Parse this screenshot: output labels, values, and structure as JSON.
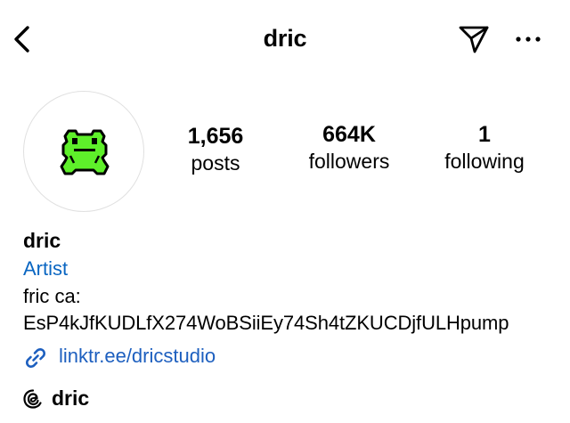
{
  "header": {
    "title": "dric",
    "back_icon": "chevron-left-icon",
    "send_icon": "paper-plane-icon",
    "more_icon": "more-horizontal-icon"
  },
  "profile": {
    "avatar_icon": "green-frog-icon",
    "stats": {
      "posts": {
        "value": "1,656",
        "label": "posts"
      },
      "followers": {
        "value": "664K",
        "label": "followers"
      },
      "following": {
        "value": "1",
        "label": "following"
      }
    }
  },
  "bio": {
    "name": "dric",
    "category": "Artist",
    "line1": "fric ca:",
    "line2": "EsP4kJfKUDLfX274WoBSiiEy74Sh4tZKUCDjfULHpump",
    "link_icon": "link-icon",
    "link_text": "linktr.ee/dricstudio",
    "threads_icon": "threads-icon",
    "threads_name": "dric"
  },
  "colors": {
    "link": "#1d5fbf",
    "category": "#0a66c2",
    "frog_green": "#5ef02a"
  }
}
